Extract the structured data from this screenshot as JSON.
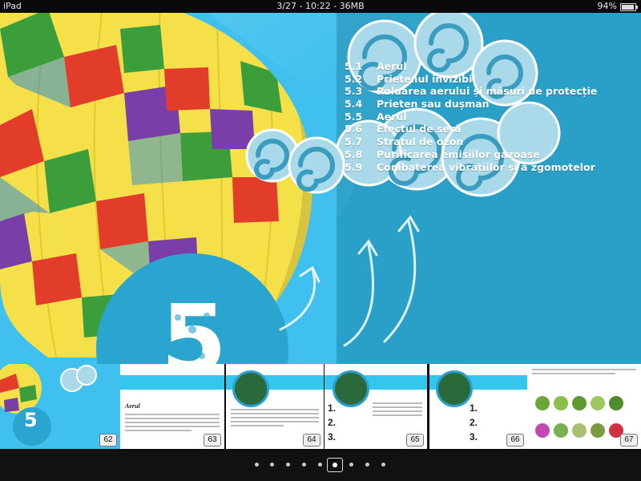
{
  "status_bar": {
    "device": "iPad",
    "center": "3/27 - 10:22 - 36MB",
    "battery": "94%"
  },
  "chapter": {
    "number": "5",
    "toc": [
      {
        "num": "5.1",
        "title": "Aerul"
      },
      {
        "num": "5.2",
        "title": "Prietenul invizibil"
      },
      {
        "num": "5.3",
        "title": "Poluarea aerului și măsuri de protecție"
      },
      {
        "num": "5.4",
        "title": "Prieten sau dușman"
      },
      {
        "num": "5.5",
        "title": "Aerul"
      },
      {
        "num": "5.6",
        "title": "Efectul de seră"
      },
      {
        "num": "5.7",
        "title": "Stratul de ozon"
      },
      {
        "num": "5.8",
        "title": "Purificarea emisiilor gazoase"
      },
      {
        "num": "5.9",
        "title": "Combaterea vibrațiilor și a zgomotelor"
      }
    ]
  },
  "thumbnails": [
    {
      "page": "62",
      "number": "5"
    },
    {
      "page": "63",
      "title": "Aerul"
    },
    {
      "page": "64"
    },
    {
      "page": "65"
    },
    {
      "page": "66"
    },
    {
      "page": "67"
    }
  ],
  "pager": {
    "count": 9,
    "active_index": 5
  },
  "colors": {
    "sky_left": "#3fc0ee",
    "sky_right": "#2aa0c8",
    "cloud": "#a9d9e8",
    "swirl": "#3a9dbf",
    "thumb_band": "#35c6ee"
  },
  "icons": [
    "balloon-illustration",
    "cloud-swirl-icon",
    "chalk-arrow-icon",
    "battery-icon",
    "globe-icon"
  ]
}
